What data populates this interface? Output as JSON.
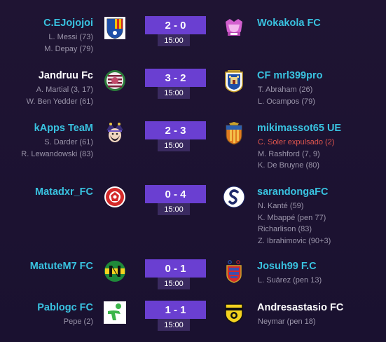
{
  "colors": {
    "background": "#1f1433",
    "score_bg": "#6a3fd1",
    "time_bg": "#3a2a60",
    "winner_or_highlight_name": "#39c2e0",
    "team_name_white": "#ffffff",
    "scorer_text": "#9b95aa",
    "red_card_text": "#e0564e"
  },
  "matches": [
    {
      "home": {
        "name": "C.EJojojoi",
        "name_color": "cyan",
        "badge": "sabadell-crest-icon",
        "scorers": [
          "L. Messi (73)",
          "M. Depay (79)"
        ]
      },
      "away": {
        "name": "Wokakola FC",
        "name_color": "cyan",
        "badge": "pink-crown-crest-icon",
        "scorers": []
      },
      "score": "2 - 0",
      "time": "15:00"
    },
    {
      "home": {
        "name": "Jandruu Fc",
        "name_color": "white",
        "badge": "striped-rose-crest-icon",
        "scorers": [
          "A. Martial (3, 17)",
          "W. Ben Yedder (61)"
        ]
      },
      "away": {
        "name": "CF mrl399pro",
        "name_color": "cyan",
        "badge": "castle-crest-icon",
        "scorers": [
          "T. Abraham (26)",
          "L. Ocampos (79)"
        ]
      },
      "score": "3 - 2",
      "time": "15:00"
    },
    {
      "home": {
        "name": "kApps TeaM",
        "name_color": "cyan",
        "badge": "jester-avatar-icon",
        "scorers": [
          "S. Darder (61)",
          "R. Lewandowski (83)"
        ]
      },
      "away": {
        "name": "mikimassot65 UE",
        "name_color": "cyan",
        "badge": "orange-shield-crest-icon",
        "scorers": [
          {
            "text": "C. Soler expulsado (2)",
            "red": true
          },
          {
            "text": "M. Rashford (7, 9)",
            "red": false
          },
          {
            "text": "K. De Bruyne (80)",
            "red": false
          }
        ]
      },
      "score": "2 - 3",
      "time": "15:00"
    },
    {
      "home": {
        "name": "Matadxr_FC",
        "name_color": "cyan",
        "badge": "red-ball-crest-icon",
        "scorers": []
      },
      "away": {
        "name": "sarandongaFC",
        "name_color": "cyan",
        "badge": "s-logo-crest-icon",
        "scorers": [
          "N. Kanté (59)",
          "K. Mbappé (pen 77)",
          "Richarlison (83)",
          "Z. Ibrahimovic (90+3)"
        ]
      },
      "score": "0 - 4",
      "time": "15:00"
    },
    {
      "home": {
        "name": "MatuteM7 FC",
        "name_color": "cyan",
        "badge": "green-yellow-n-crest-icon",
        "scorers": []
      },
      "away": {
        "name": "Josuh99 F.C",
        "name_color": "cyan",
        "badge": "olympic-shield-crest-icon",
        "scorers": [
          "L. Suárez (pen 13)"
        ]
      },
      "score": "0 - 1",
      "time": "15:00"
    },
    {
      "home": {
        "name": "Pablogc FC",
        "name_color": "cyan",
        "badge": "green-figure-crest-icon",
        "scorers": [
          "Pepe (2)"
        ]
      },
      "away": {
        "name": "Andresastasio FC",
        "name_color": "white",
        "badge": "yellow-black-shield-crest-icon",
        "scorers": [
          "Neymar (pen 18)"
        ]
      },
      "score": "1 - 1",
      "time": "15:00"
    }
  ]
}
